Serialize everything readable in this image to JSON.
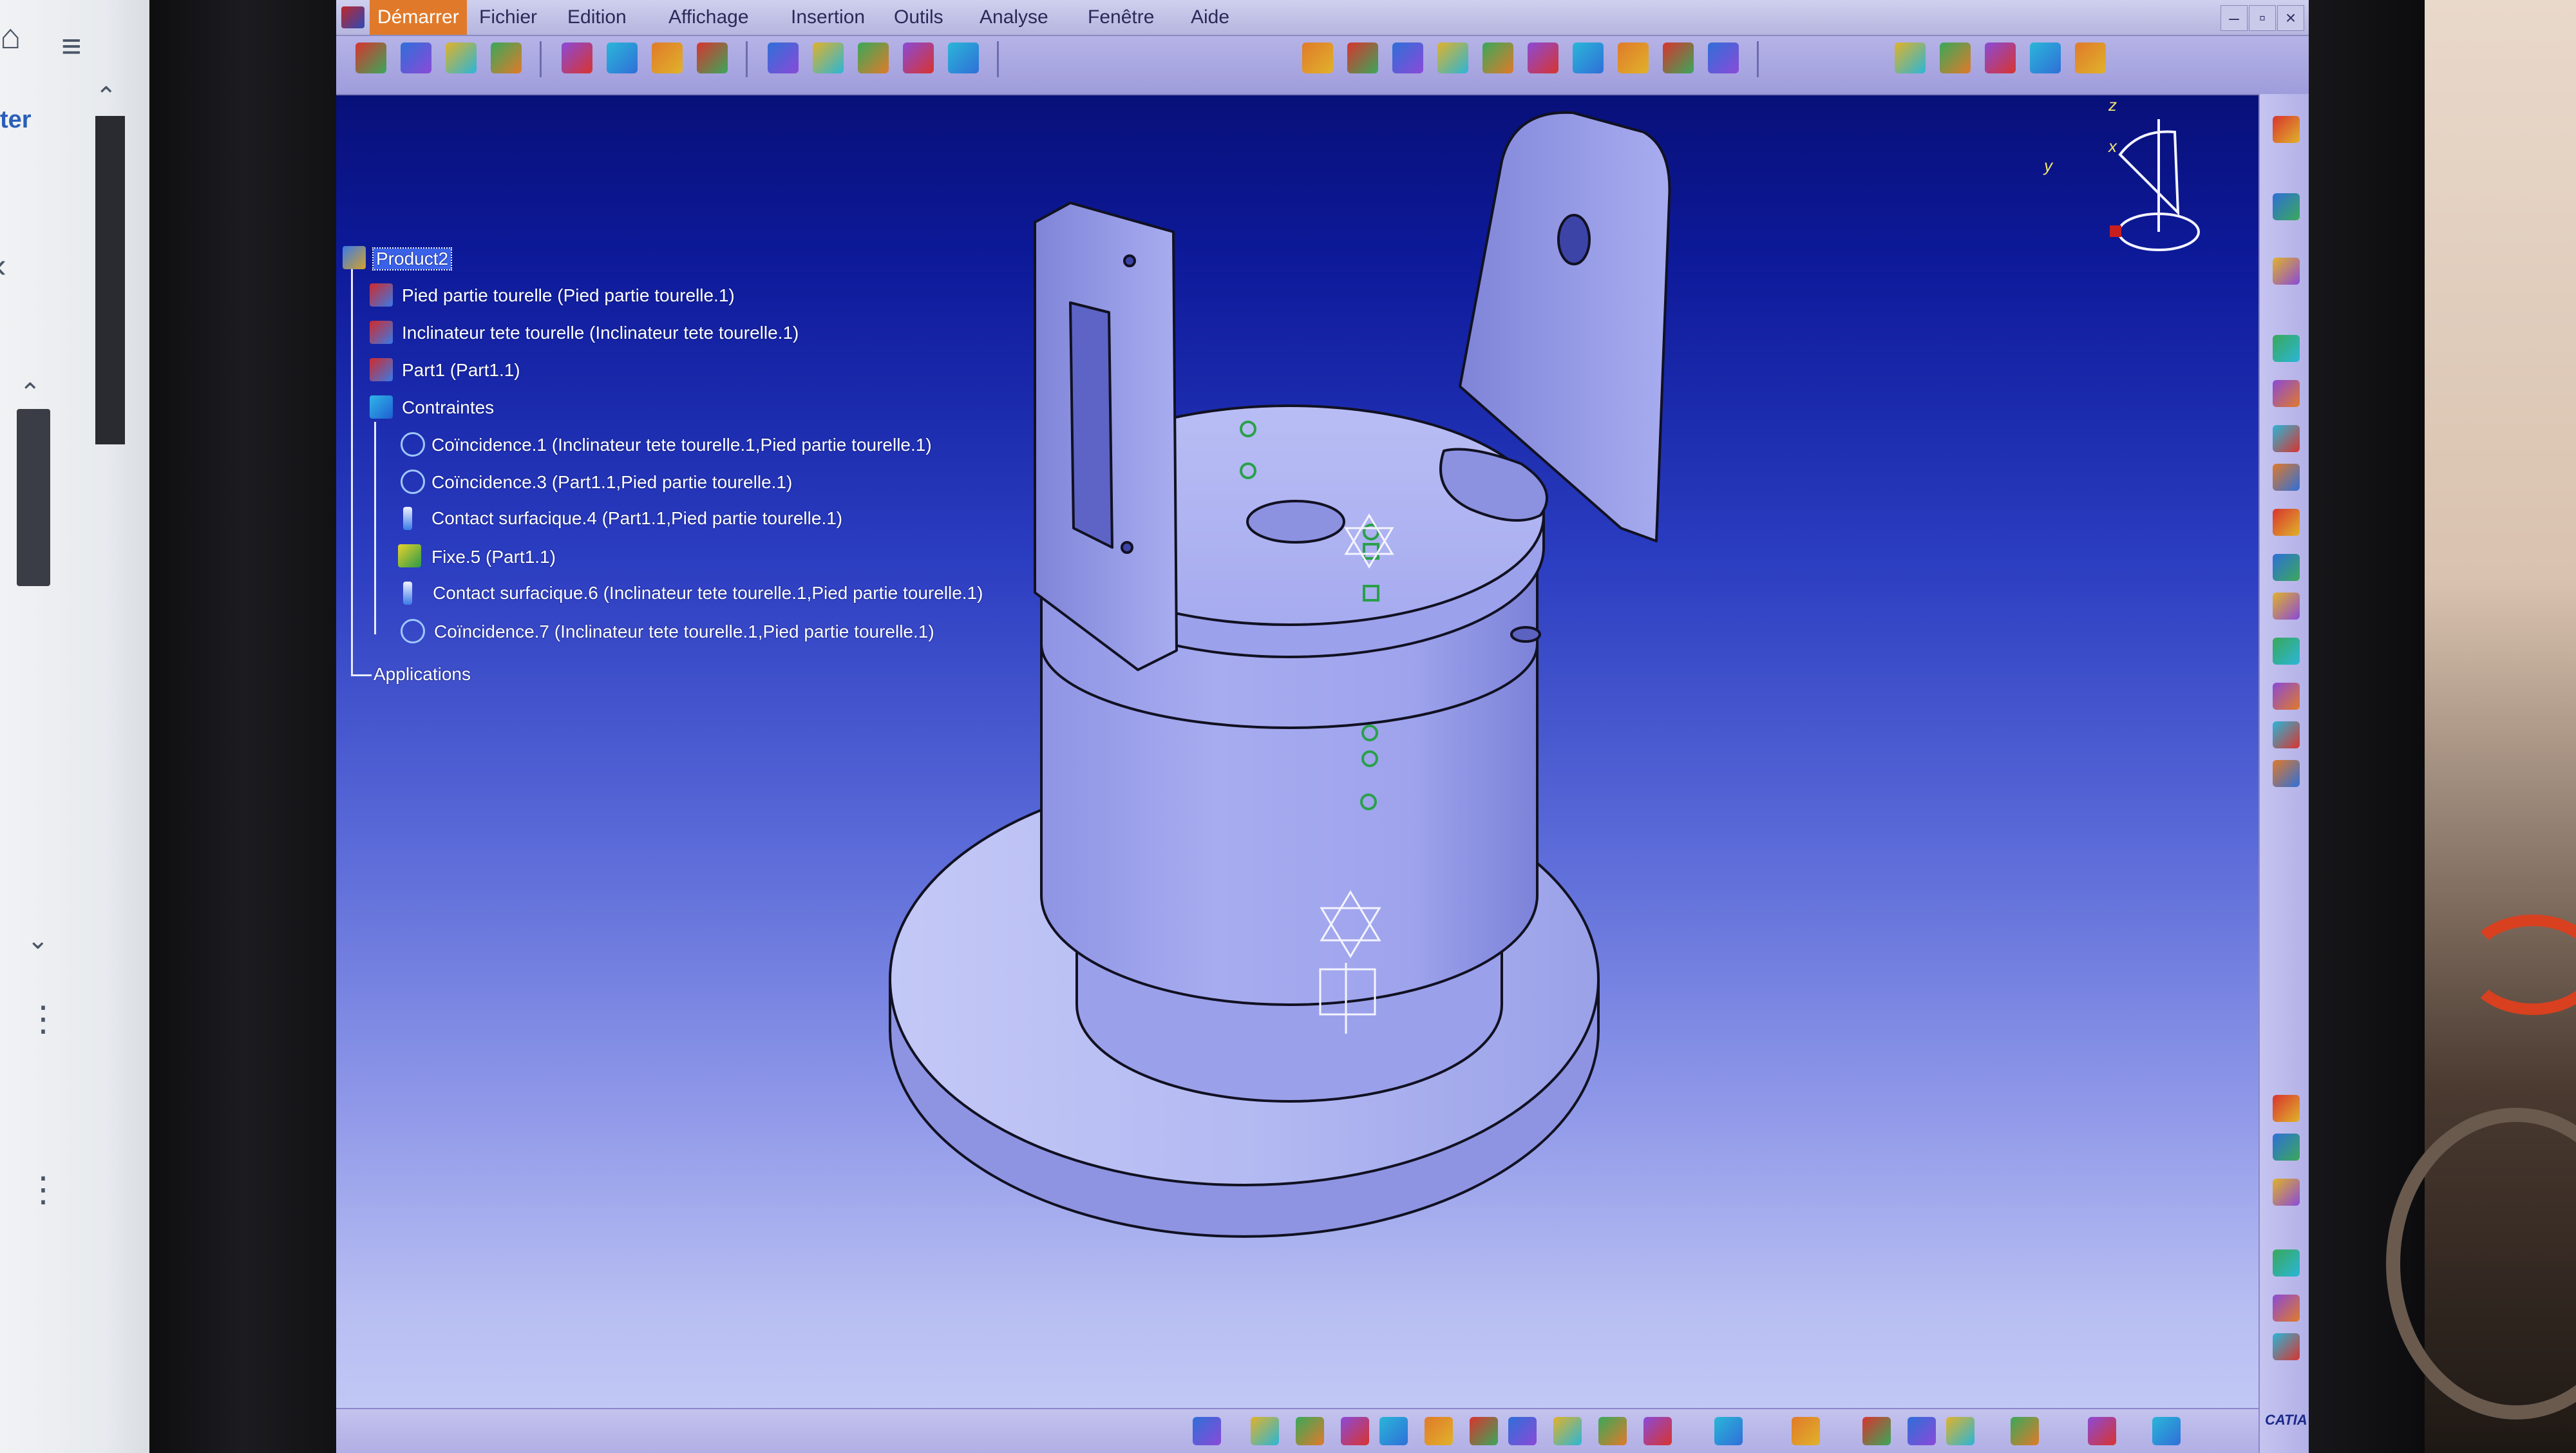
{
  "left_window": {
    "partial_text": "ter"
  },
  "menu": {
    "items": [
      {
        "label": "Démarrer",
        "active": true
      },
      {
        "label": "Fichier"
      },
      {
        "label": "Edition"
      },
      {
        "label": "Affichage"
      },
      {
        "label": "Insertion"
      },
      {
        "label": "Outils"
      },
      {
        "label": "Analyse"
      },
      {
        "label": "Fenêtre"
      },
      {
        "label": "Aide"
      }
    ]
  },
  "window_controls": {
    "minimize": "–",
    "restore": "▫",
    "close": "×"
  },
  "toolbar_icons": [
    "new-product-icon",
    "new-component-icon",
    "existing-component-icon",
    "replace-component-icon",
    "graph-tree-icon",
    "generate-numbering-icon",
    "select-icon",
    "bill-of-material-icon",
    "sectioning-icon",
    "clash-icon",
    "snap-icon",
    "explode-icon",
    "stop-manipulate-icon",
    "coincidence-constraint-icon",
    "contact-constraint-icon",
    "offset-constraint-icon",
    "angle-constraint-icon",
    "fix-icon",
    "fix-together-icon",
    "quick-constraint-icon",
    "flexible-rigid-icon",
    "change-constraint-icon",
    "reuse-pattern-icon",
    "update-icon",
    "measure-icon",
    "catalog-icon",
    "fly-mode-icon",
    "publish-icon"
  ],
  "tree": {
    "root": "Product2",
    "nodes": [
      {
        "label": "Pied partie tourelle (Pied partie tourelle.1)",
        "type": "part"
      },
      {
        "label": "Inclinateur tete tourelle (Inclinateur tete tourelle.1)",
        "type": "part"
      },
      {
        "label": "Part1 (Part1.1)",
        "type": "part"
      },
      {
        "label": "Contraintes",
        "type": "constraints"
      },
      {
        "label": "Coïncidence.1 (Inclinateur tete tourelle.1,Pied partie tourelle.1)",
        "type": "coincidence"
      },
      {
        "label": "Coïncidence.3 (Part1.1,Pied partie tourelle.1)",
        "type": "coincidence"
      },
      {
        "label": "Contact surfacique.4 (Part1.1,Pied partie tourelle.1)",
        "type": "contact"
      },
      {
        "label": "Fixe.5 (Part1.1)",
        "type": "fix"
      },
      {
        "label": "Contact surfacique.6 (Inclinateur tete tourelle.1,Pied partie tourelle.1)",
        "type": "contact"
      },
      {
        "label": "Coïncidence.7 (Inclinateur tete tourelle.1,Pied partie tourelle.1)",
        "type": "coincidence"
      },
      {
        "label": "Applications",
        "type": "applications"
      }
    ]
  },
  "compass": {
    "x": "x",
    "y": "y",
    "z": "z"
  },
  "brand": "CATIA",
  "colors": {
    "model_face": "#a9aef0",
    "model_edge": "#111122",
    "constraint_marker": "#2aa04a",
    "menu_active": "#e07a2a",
    "tree_selected": "#3a62e8"
  }
}
